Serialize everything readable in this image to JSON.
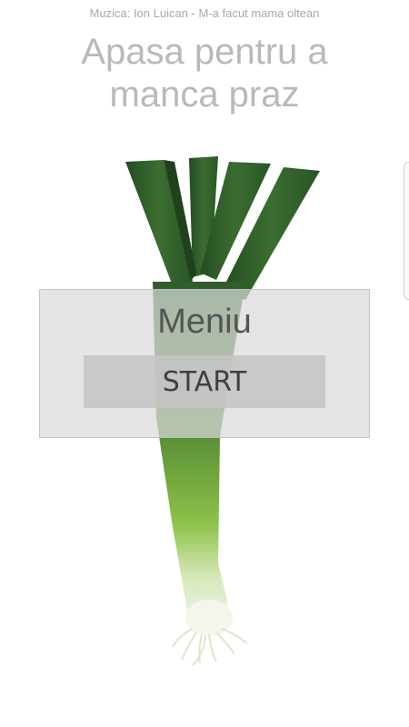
{
  "header": {
    "music_credit": "Muzica: Ion Luican - M-a facut mama oltean",
    "title": "Apasa pentru a manca praz"
  },
  "menu": {
    "title": "Meniu",
    "start_label": "START"
  },
  "colors": {
    "leek_dark_green": "#2f5e2a",
    "leek_light_green": "#8fc24a",
    "leek_white": "#f2f5ea",
    "panel_gray": "#dadada",
    "button_gray": "#c4c4c4"
  }
}
